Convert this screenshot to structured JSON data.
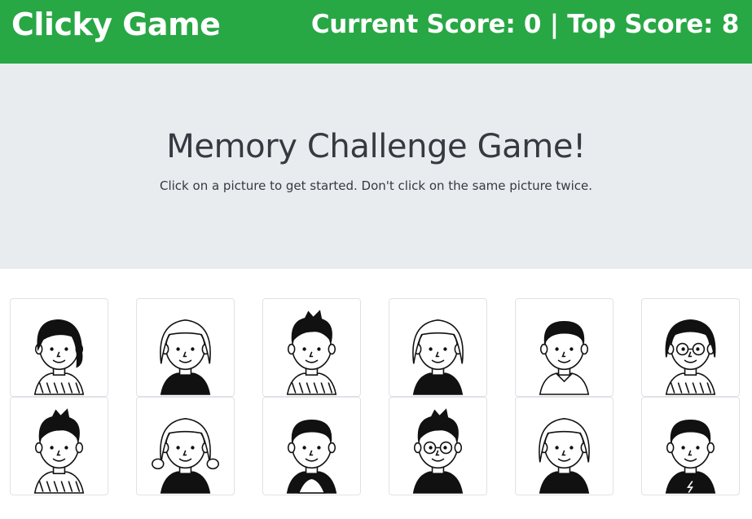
{
  "navbar": {
    "brand": "Clicky Game",
    "score_text": "Current Score: 0 | Top Score: 8"
  },
  "jumbotron": {
    "title": "Memory Challenge Game!",
    "instructions": "Click on a picture to get started. Don't click on the same picture twice."
  },
  "colors": {
    "navbar_bg": "#28a745",
    "jumbotron_bg": "#e9ecef"
  },
  "cards": [
    {
      "name": "girl-side-hair-avatar"
    },
    {
      "name": "girl-wavy-hair-avatar"
    },
    {
      "name": "boy-spiky-hair-avatar"
    },
    {
      "name": "girl-curly-hair-avatar"
    },
    {
      "name": "boy-collar-shirt-avatar"
    },
    {
      "name": "girl-glasses-avatar"
    },
    {
      "name": "boy-plaid-shirt-avatar"
    },
    {
      "name": "girl-pigtails-avatar"
    },
    {
      "name": "boy-short-hair-avatar"
    },
    {
      "name": "boy-glasses-avatar"
    },
    {
      "name": "girl-bangs-avatar"
    },
    {
      "name": "boy-bolt-shirt-avatar"
    }
  ]
}
